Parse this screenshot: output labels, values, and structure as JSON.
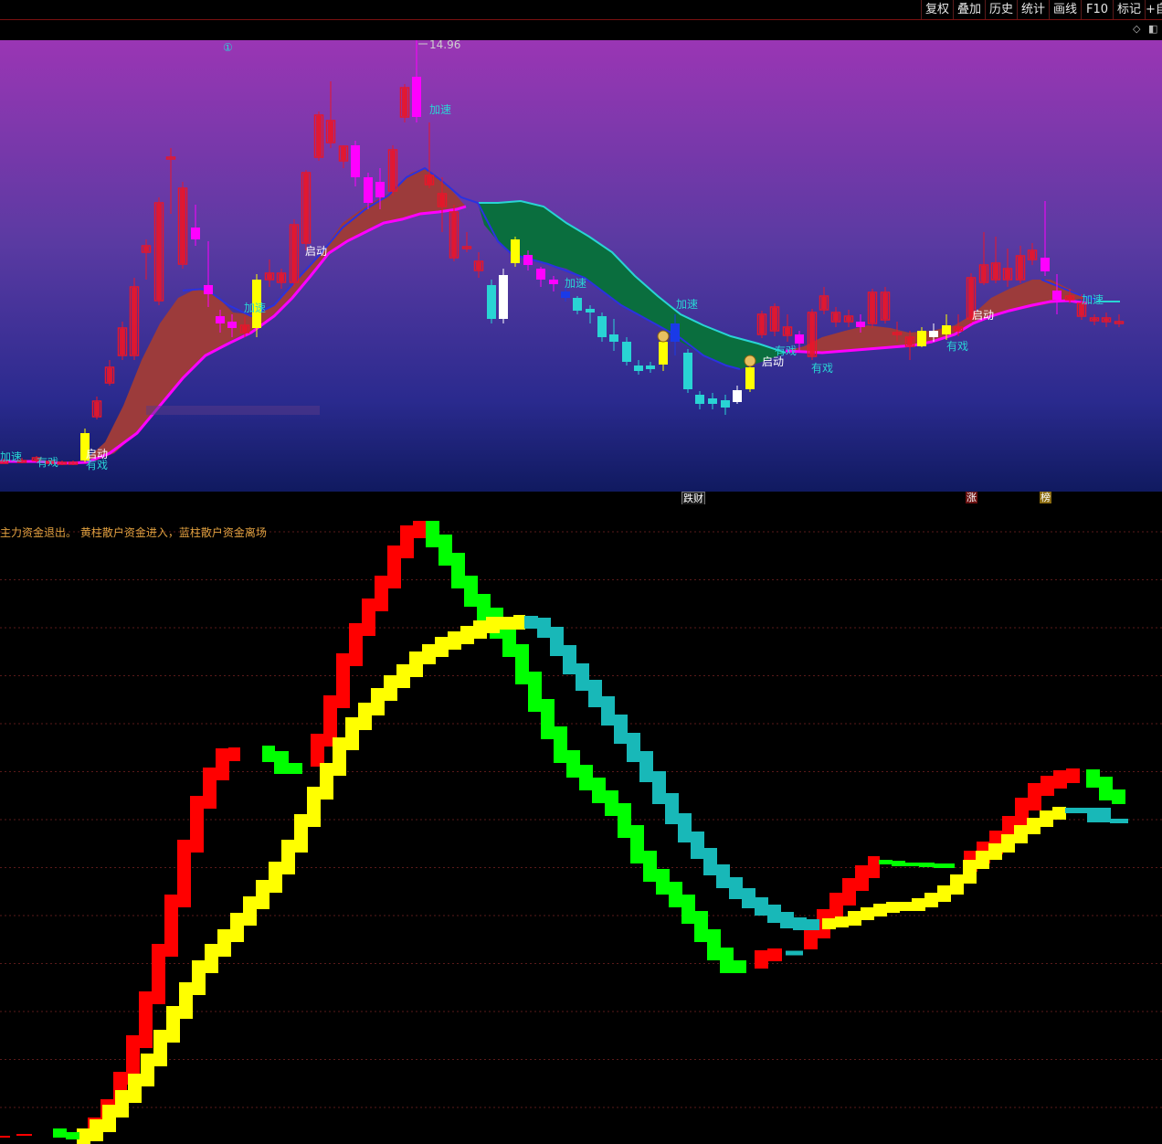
{
  "toolbar": {
    "buttons": [
      "复权",
      "叠加",
      "历史",
      "统计",
      "画线",
      "F10",
      "标记",
      "+自"
    ]
  },
  "strip": {
    "diamond_icon": "diamond-icon",
    "window_icon": "window-icon"
  },
  "chart": {
    "high_price_label": "14.96",
    "circle_label": "①",
    "signal_labels": {
      "accelerate": "加速",
      "start": "启动",
      "show": "有戏"
    },
    "markers": [
      "跌财",
      "涨",
      "榜"
    ]
  },
  "indicator": {
    "legend_text": "主力资金退出。 黄柱散户资金进入，蓝柱散户资金离场"
  },
  "colors": {
    "up": "#e8162a",
    "down": "#29d4d4",
    "magenta": "#ff00ff",
    "yellow": "#ffff00",
    "green_bar": "#00ff00",
    "red_bar": "#ff0000",
    "cyan_bar": "#18b8b8",
    "brown_fill": "#9c3b3b",
    "green_fill": "#0a6e3e"
  }
}
